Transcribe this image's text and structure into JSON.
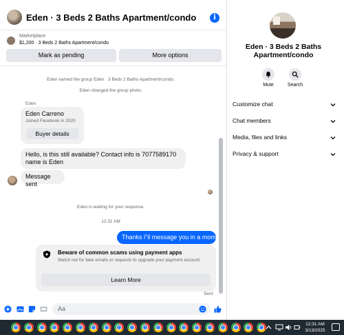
{
  "chat": {
    "title": "Eden · 3 Beds 2 Baths Apartment/condo",
    "info_icon": "i",
    "marketplace": {
      "label": "Marketplace",
      "listing": "$1,200 · 3 Beds 2 Baths Apartment/condo",
      "mark_pending": "Mark as pending",
      "more_options": "More options"
    },
    "system_messages": {
      "named_group": "Eden named the group Eden · 3 Beds 2 Baths Apartment/condo.",
      "changed_photo": "Eden changed the group photo.",
      "waiting": "Eden is waiting for your response.",
      "timestamp": "12:31 AM"
    },
    "sender_name": "Eden",
    "buyer_card": {
      "name": "Eden Carreno",
      "joined": "Joined Facebook in 2020",
      "button": "Buyer details"
    },
    "messages": {
      "availability": "Hello, is this still available? Contact info is 7077589170 name is Eden",
      "sent_notice": "Message sent",
      "outgoing": "Thanks i\"il message you in a moment"
    },
    "scam_notice": {
      "title": "Beware of common scams using payment apps",
      "description": "Watch out for fake emails or requests to upgrade your payment account.",
      "button": "Learn More"
    },
    "status": "Sent",
    "composer_placeholder": "Aa",
    "icons": [
      "plus-circle-icon",
      "photo-icon",
      "sticker-icon",
      "gif-icon",
      "emoji-icon",
      "thumbs-up-icon"
    ]
  },
  "sidebar": {
    "name": "Eden · 3 Beds 2 Baths Apartment/condo",
    "actions": [
      {
        "label": "Mute",
        "icon": "bell-icon"
      },
      {
        "label": "Search",
        "icon": "search-icon"
      }
    ],
    "sections": [
      "Customize chat",
      "Chat members",
      "Media, files and links",
      "Privacy & support"
    ]
  },
  "taskbar": {
    "time": "12:31 AM",
    "date": "3/13/2025",
    "app_count": 20
  },
  "colors": {
    "accent": "#0866ff",
    "bubble_in": "#f0f0f0",
    "button_bg": "#e4e6eb",
    "taskbar": "#202a33"
  }
}
